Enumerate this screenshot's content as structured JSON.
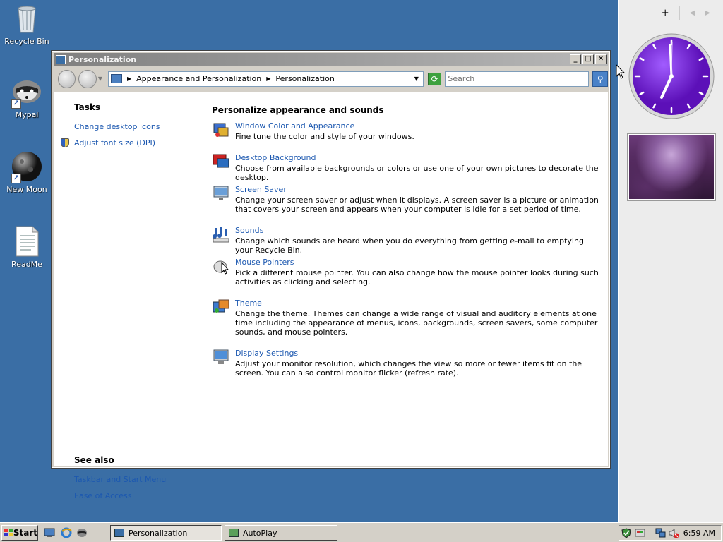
{
  "desktop": {
    "icons": [
      {
        "label": "Recycle Bin"
      },
      {
        "label": "Mypal"
      },
      {
        "label": "New Moon"
      },
      {
        "label": "ReadMe"
      }
    ]
  },
  "window": {
    "title": "Personalization",
    "buttons": {
      "minimize": "_",
      "maximize": "□",
      "close": "✕"
    },
    "address": {
      "crumbs": [
        "Appearance and Personalization",
        "Personalization"
      ],
      "search_placeholder": "Search"
    },
    "tasks": {
      "heading": "Tasks",
      "links": [
        "Change desktop icons",
        "Adjust font size (DPI)"
      ]
    },
    "see_also": {
      "heading": "See also",
      "links": [
        "Taskbar and Start Menu",
        "Ease of Access"
      ]
    },
    "main": {
      "heading": "Personalize appearance and sounds",
      "items": [
        {
          "title": "Window Color and Appearance",
          "desc": "Fine tune the color and style of your windows.",
          "icon": "color-palette-icon"
        },
        {
          "title": "Desktop Background",
          "desc": "Choose from available backgrounds or colors or use one of your own pictures to decorate the desktop.",
          "icon": "desktop-background-icon"
        },
        {
          "title": "Screen Saver",
          "desc": "Change your screen saver or adjust when it displays. A screen saver is a picture or animation that covers your screen and appears when your computer is idle for a set period of time.",
          "icon": "screen-saver-icon"
        },
        {
          "title": "Sounds",
          "desc": "Change which sounds are heard when you do everything from getting e-mail to emptying your Recycle Bin.",
          "icon": "sounds-icon"
        },
        {
          "title": "Mouse Pointers",
          "desc": "Pick a different mouse pointer. You can also change how the mouse pointer looks during such activities as clicking and selecting.",
          "icon": "mouse-pointer-icon"
        },
        {
          "title": "Theme",
          "desc": "Change the theme. Themes can change a wide range of visual and auditory elements at one time including the appearance of menus, icons, backgrounds, screen savers, some computer sounds, and mouse pointers.",
          "icon": "theme-icon"
        },
        {
          "title": "Display Settings",
          "desc": "Adjust your monitor resolution, which changes the view so more or fewer items fit on the screen. You can also control monitor flicker (refresh rate).",
          "icon": "display-settings-icon"
        }
      ]
    }
  },
  "sidebar": {
    "add": "+",
    "prev": "◀",
    "next": "▶"
  },
  "taskbar": {
    "start_label": "Start",
    "tasks": [
      "Personalization",
      "AutoPlay"
    ],
    "clock": "6:59 AM"
  },
  "colors": {
    "desktop": "#3a6ea5",
    "link": "#1c58b0",
    "clock_face": "#7a1fe0"
  }
}
